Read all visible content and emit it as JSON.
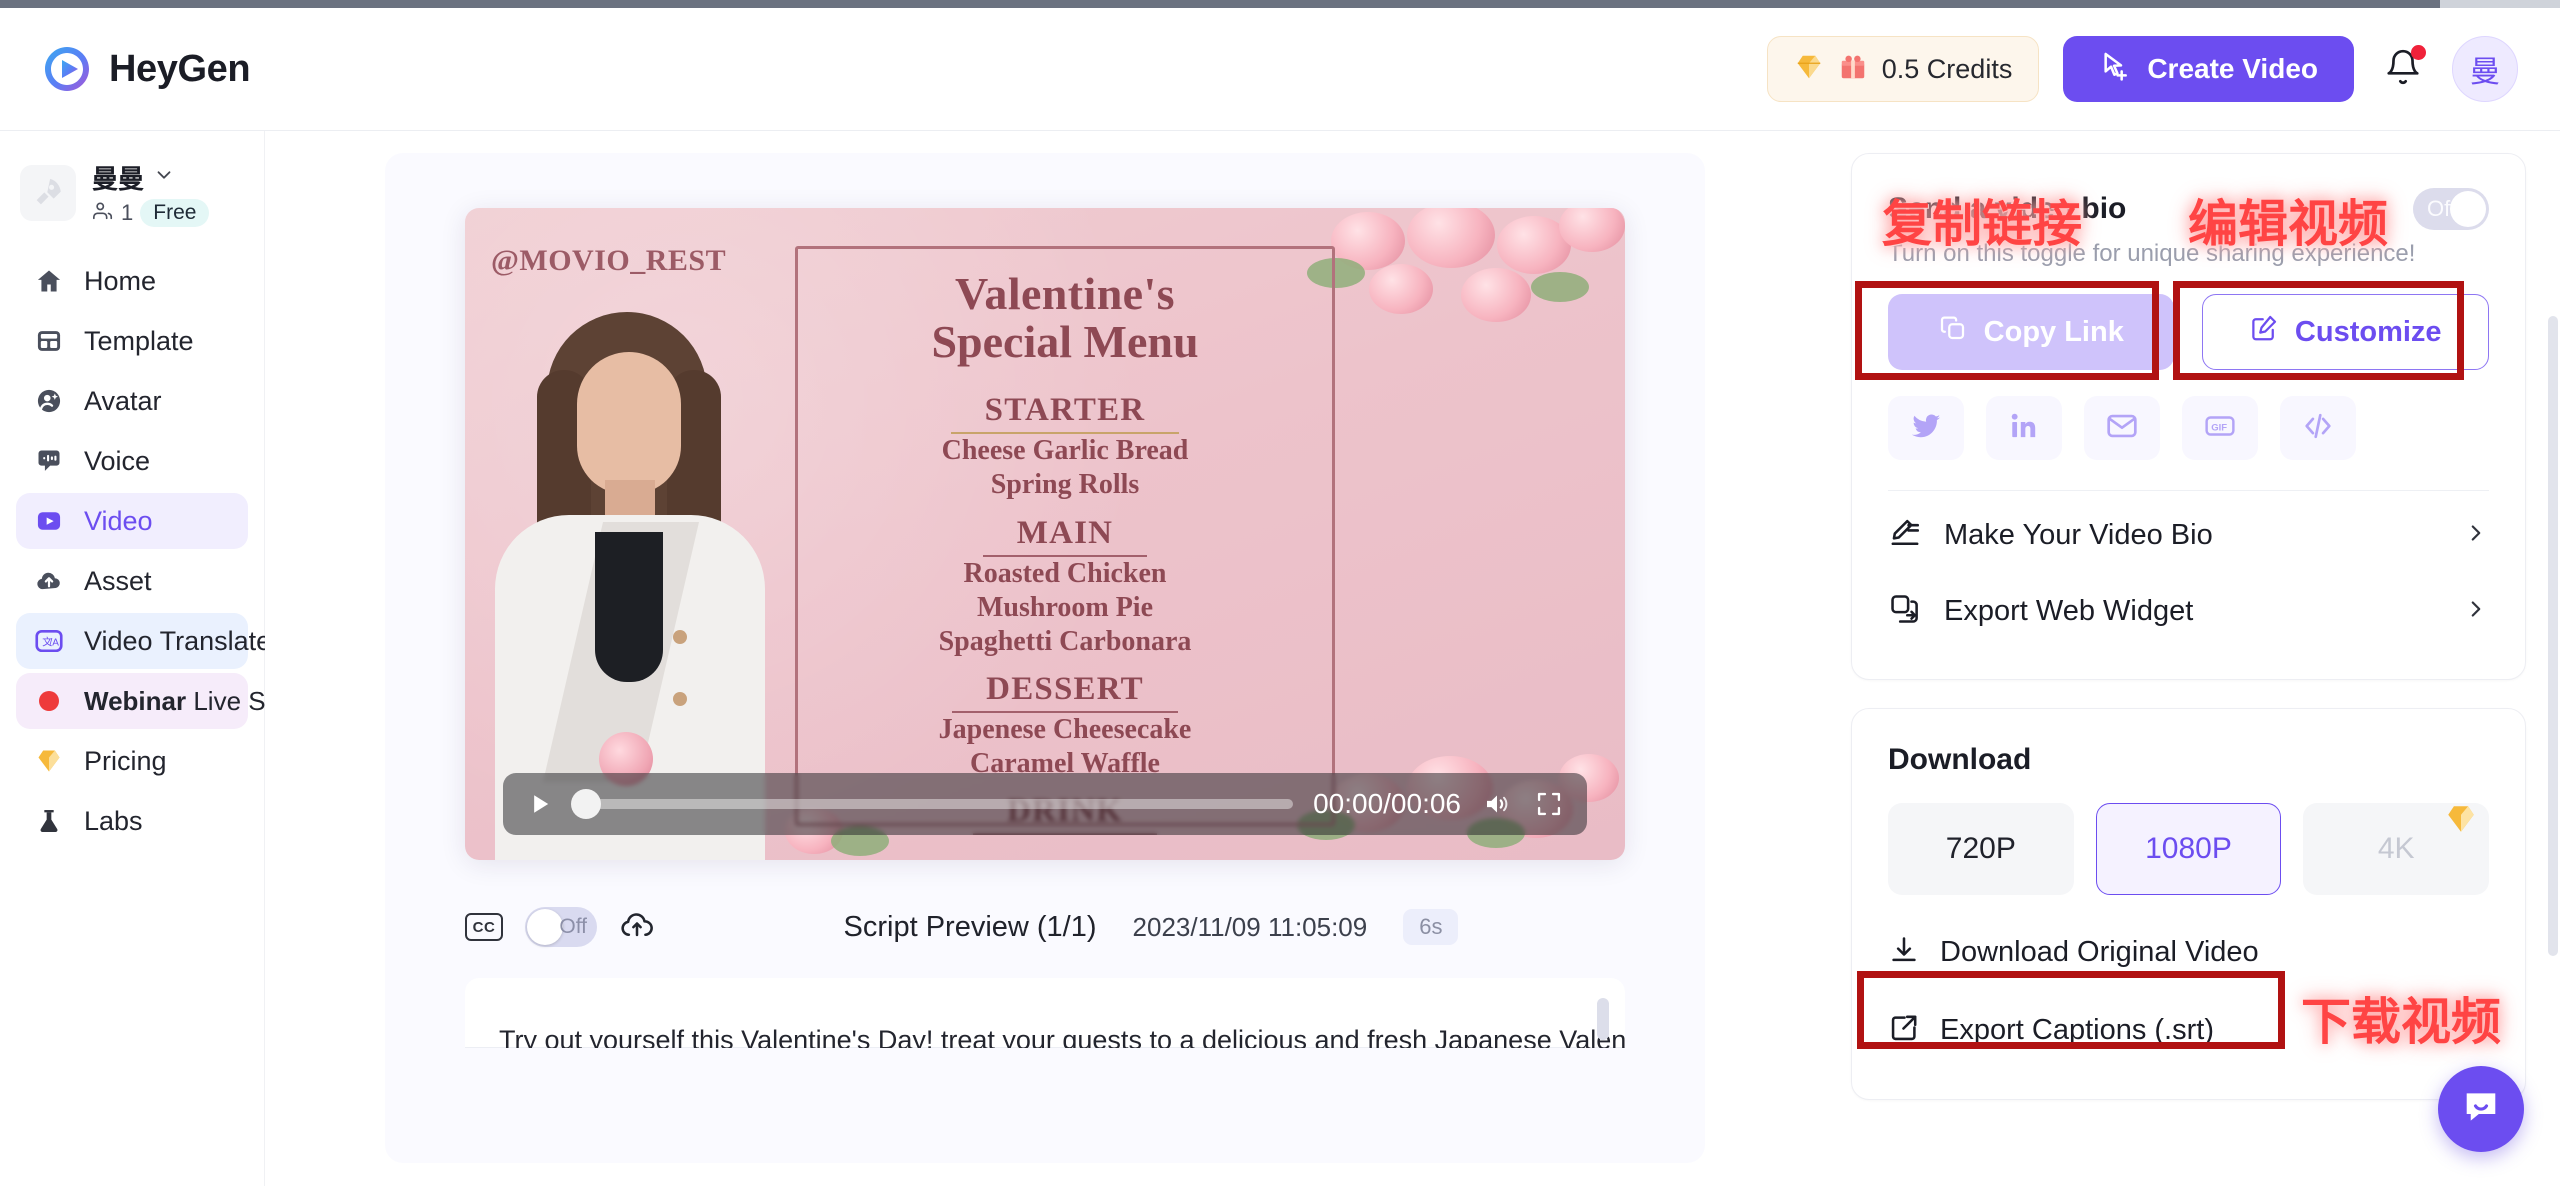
{
  "header": {
    "brand": "HeyGen",
    "brand_logo_icon": "heygen-play-logo",
    "credits": "0.5 Credits",
    "credits_gem_icon": "diamond-icon",
    "credits_gift_icon": "gift-icon",
    "create_video": "Create Video",
    "create_video_icon": "cursor-plus-icon",
    "notifications_icon": "bell-icon",
    "avatar_initial": "曼"
  },
  "sidebar": {
    "workspace_name": "曼曼",
    "workspace_icon": "rocket-icon",
    "workspace_chevron_icon": "chevron-down-icon",
    "members_icon": "users-icon",
    "members_count": "1",
    "plan_badge": "Free",
    "items": [
      {
        "label": "Home",
        "icon": "home-icon"
      },
      {
        "label": "Template",
        "icon": "template-icon"
      },
      {
        "label": "Avatar",
        "icon": "avatar-icon"
      },
      {
        "label": "Voice",
        "icon": "voice-icon"
      },
      {
        "label": "Video",
        "icon": "video-icon"
      },
      {
        "label": "Asset",
        "icon": "cloud-upload-icon"
      },
      {
        "label": "Video Translate",
        "icon": "translate-icon"
      },
      {
        "label": "Pricing",
        "icon": "diamond-icon"
      },
      {
        "label": "Labs",
        "icon": "flask-icon"
      }
    ],
    "webinar": {
      "bold": "Webinar",
      "rest": "Live Soon",
      "dot_icon": "red-dot-icon",
      "chevron_icon": "chevron-right-icon"
    },
    "translate_chevron_icon": "chevron-right-icon"
  },
  "video": {
    "watermark": "@MOVIO_REST",
    "menu": {
      "title_line1": "Valentine's",
      "title_line2": "Special Menu",
      "sections": [
        {
          "heading": "STARTER",
          "items": [
            "Cheese Garlic Bread",
            "Spring Rolls"
          ]
        },
        {
          "heading": "MAIN",
          "items": [
            "Roasted Chicken",
            "Mushroom Pie",
            "Spaghetti Carbonara"
          ]
        },
        {
          "heading": "DESSERT",
          "items": [
            "Japenese Cheesecake",
            "Caramel Waffle"
          ]
        },
        {
          "heading": "DRINK",
          "items": []
        }
      ]
    },
    "controls": {
      "play_icon": "play-icon",
      "time": "00:00/00:06",
      "volume_icon": "volume-icon",
      "fullscreen_icon": "fullscreen-icon",
      "progress_percent": 0
    }
  },
  "script": {
    "cc_icon": "cc-icon",
    "cc_toggle_state": "Off",
    "upload_icon": "cloud-upload-icon",
    "title": "Script Preview (1/1)",
    "date": "2023/11/09 11:05:09",
    "duration": "6s",
    "text": "Try out yourself this Valentine's Day! treat your guests to a delicious and fresh Japanese Valentine"
  },
  "share_panel": {
    "title": "Send a video bio",
    "toggle_label": "Off",
    "subtitle": "Turn on this toggle for unique sharing experience!",
    "copy_link": "Copy Link",
    "copy_link_icon": "copy-icon",
    "customize": "Customize",
    "customize_icon": "edit-square-icon",
    "socials": [
      {
        "name": "twitter-icon"
      },
      {
        "name": "linkedin-icon"
      },
      {
        "name": "email-icon"
      },
      {
        "name": "gif-icon"
      },
      {
        "name": "embed-code-icon"
      }
    ],
    "rows": [
      {
        "label": "Make Your Video Bio",
        "icon": "pen-line-icon",
        "chevron_icon": "chevron-right-icon"
      },
      {
        "label": "Export Web Widget",
        "icon": "widget-export-icon",
        "chevron_icon": "chevron-right-icon"
      }
    ]
  },
  "download_panel": {
    "title": "Download",
    "qualities": [
      {
        "label": "720P",
        "state": "normal"
      },
      {
        "label": "1080P",
        "state": "selected"
      },
      {
        "label": "4K",
        "state": "disabled",
        "badge_icon": "diamond-icon"
      }
    ],
    "rows": [
      {
        "label": "Download Original Video",
        "icon": "download-icon"
      },
      {
        "label": "Export Captions (.srt)",
        "icon": "external-link-icon"
      }
    ]
  },
  "annotations": [
    {
      "text": "复制链接",
      "for": "copy-link"
    },
    {
      "text": "编辑视频",
      "for": "customize"
    },
    {
      "text": "下载视频",
      "for": "download-original-video"
    }
  ],
  "chat_widget": {
    "icon": "chat-bubble-icon"
  },
  "colors": {
    "accent": "#6c4df0",
    "accent_light": "#cfc3fb",
    "annotation_red": "#b11212",
    "annotation_text": "#ff4444",
    "free_badge_bg": "#e4f7f6"
  }
}
